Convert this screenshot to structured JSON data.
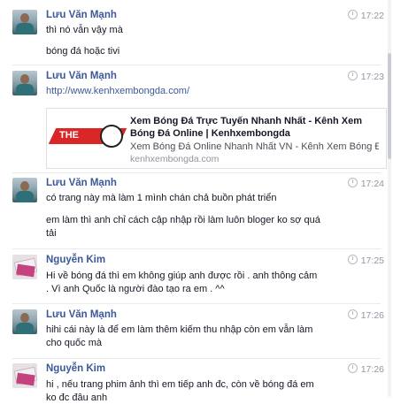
{
  "messages": [
    {
      "sender": "Lưu Văn Mạnh",
      "time": "17:22",
      "lines": [
        "thì nó vẫn vậy mà",
        "bóng đá hoặc tivi"
      ]
    },
    {
      "sender": "Lưu Văn Mạnh",
      "time": "17:23",
      "link": "http://www.kenhxembongda.com/",
      "preview": {
        "title": "Xem Bóng Đá Trực Tuyến Nhanh Nhất - Kênh Xem Bóng Đá Online | Kenhxembongda",
        "description": "Xem Bóng Đá Online Nhanh Nhất VN - Kênh Xem Bóng Đá miễ...",
        "domain": "kenhxembongda.com",
        "thumb_text": "THE"
      }
    },
    {
      "sender": "Lưu Văn Mạnh",
      "time": "17:24",
      "lines": [
        "có trang này mà làm 1 mình chán chả buồn phát triển",
        "em làm thì anh chỉ cách cập nhập rồi làm luôn bloger ko sợ quá",
        "tải"
      ]
    },
    {
      "sender": "Nguyễn Kim",
      "time": "17:25",
      "lines": [
        "Hi về bóng  đá thì em không giúp anh được rồi . anh thông cảm",
        ". Vì anh Quốc là người đào tạo ra em . ^^"
      ]
    },
    {
      "sender": "Lưu Văn Mạnh",
      "time": "17:26",
      "lines": [
        "hihi cái này là để em làm thêm kiếm thu nhập còn em vẫn làm",
        "cho quốc mà"
      ]
    },
    {
      "sender": "Nguyễn Kim",
      "time": "17:26",
      "lines": [
        "hi , nếu trang phim ảnh thì em tiếp anh đc, còn về bóng đá em",
        "ko đc đâu anh"
      ]
    }
  ]
}
